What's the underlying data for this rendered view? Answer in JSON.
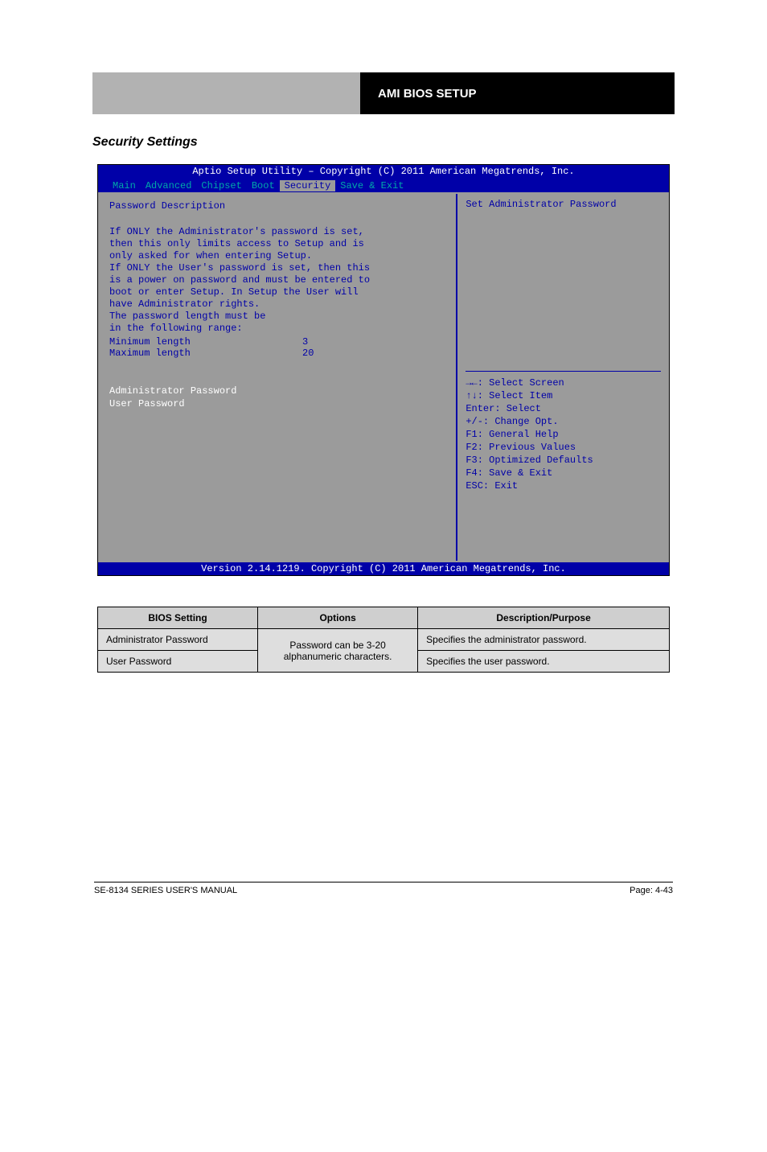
{
  "header": {
    "right_text": "AMI BIOS SETUP"
  },
  "subheading": "Security Settings",
  "bios": {
    "title": "Aptio Setup Utility – Copyright (C) 2011 American Megatrends, Inc.",
    "tabs": [
      "Main",
      "Advanced",
      "Chipset",
      "Boot",
      "Security",
      "Save & Exit"
    ],
    "active_tab_index": 4,
    "left": {
      "desc_title": "Password Description",
      "desc_lines": [
        "If ONLY the Administrator's password is set,",
        "then this only limits access to Setup and is",
        "only asked for when entering Setup.",
        "If ONLY the User's password is set, then this",
        "is a power on password and must be entered to",
        "boot or enter Setup. In Setup the User will",
        "have Administrator rights.",
        "The password length must be",
        "in the following range:"
      ],
      "ranges": [
        {
          "label": "Minimum length",
          "value": "3"
        },
        {
          "label": "Maximum length",
          "value": "20"
        }
      ],
      "options": [
        "Administrator Password",
        "User Password"
      ]
    },
    "right": {
      "help_top": "Set Administrator Password",
      "keys": [
        "→←: Select Screen",
        "↑↓: Select Item",
        "Enter: Select",
        "+/-: Change Opt.",
        "F1: General Help",
        "F2: Previous Values",
        "F3: Optimized Defaults",
        "F4: Save & Exit",
        "ESC: Exit"
      ]
    },
    "footer": "Version 2.14.1219. Copyright (C) 2011 American Megatrends, Inc."
  },
  "table": {
    "headers": [
      "BIOS Setting",
      "Options",
      "Description/Purpose"
    ],
    "rows": [
      {
        "setting": "Administrator Password",
        "options": [
          "Password can be 3-20",
          "alphanumeric characters."
        ],
        "options_rowspan": 2,
        "desc": "Specifies the administrator password."
      },
      {
        "setting": "User Password",
        "desc": "Specifies the user password."
      }
    ]
  },
  "footer": {
    "left": "SE-8134 SERIES USER'S MANUAL",
    "right": "Page: 4-43"
  }
}
